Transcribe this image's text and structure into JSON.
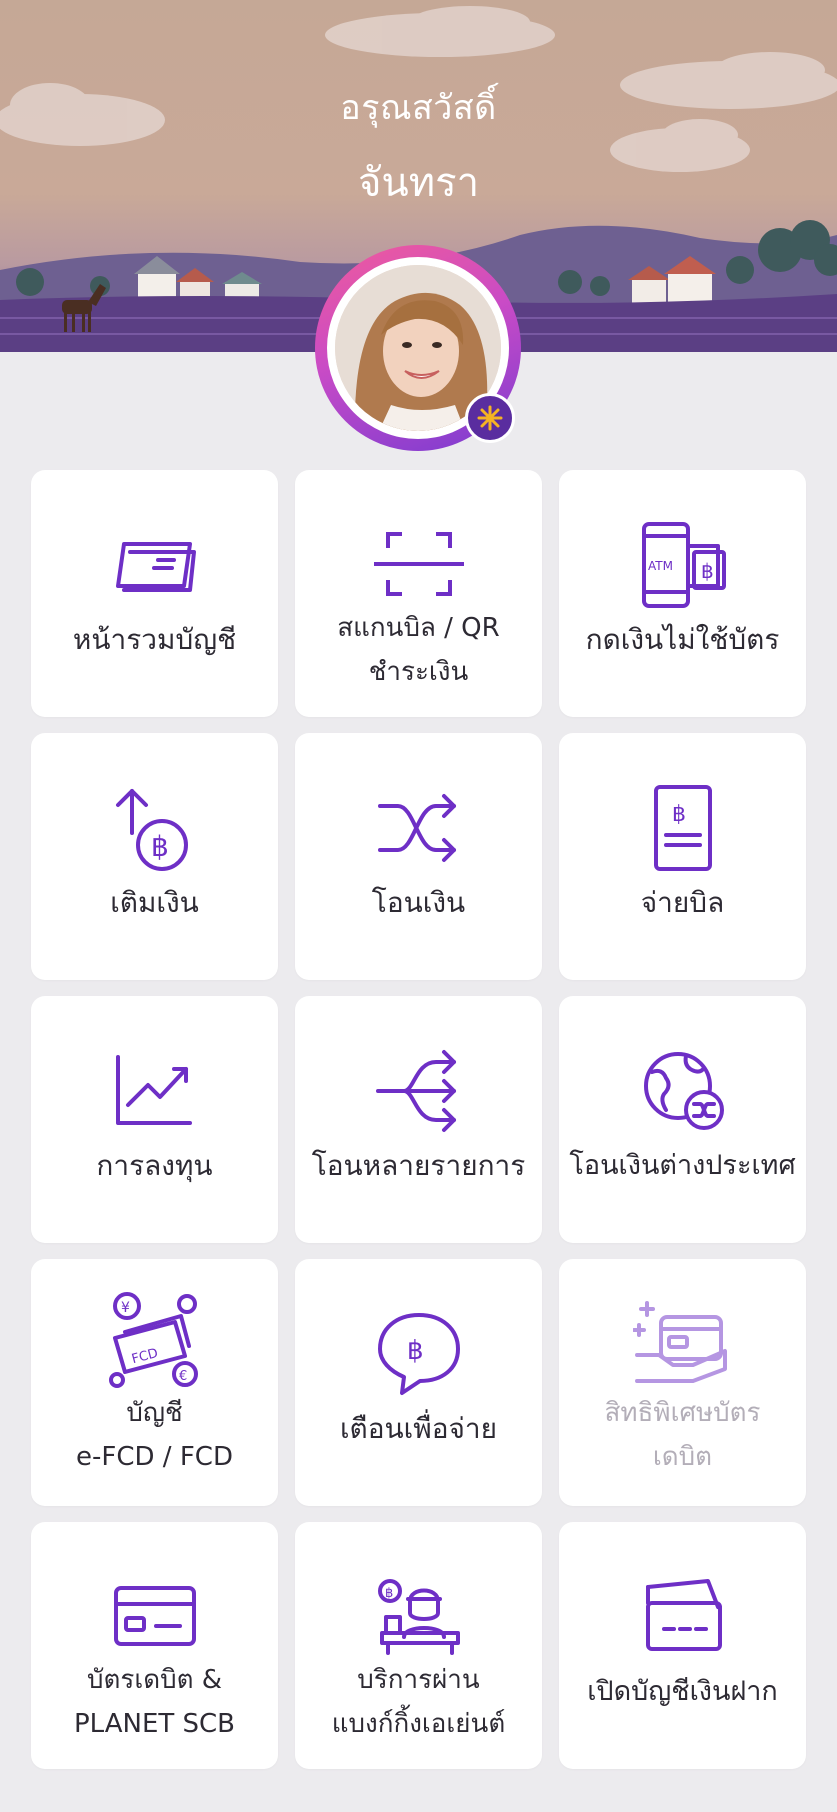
{
  "header": {
    "greeting": "อรุณสวัสดิ์",
    "username": "จันทรา"
  },
  "colors": {
    "accent": "#6E2FC6",
    "tile_background": "#FFFFFF",
    "page_background": "#ECEBEE",
    "disabled_text": "#B3AEB8"
  },
  "menu": [
    {
      "icon": "account-summary-icon",
      "label": "หน้ารวมบัญชี",
      "line2": "",
      "enabled": true
    },
    {
      "icon": "scan-qr-icon",
      "label": "สแกนบิล / QR",
      "line2": "ชำระเงิน",
      "enabled": true
    },
    {
      "icon": "atm-cardless-icon",
      "label": "กดเงินไม่ใช้บัตร",
      "line2": "",
      "enabled": true
    },
    {
      "icon": "top-up-icon",
      "label": "เติมเงิน",
      "line2": "",
      "enabled": true
    },
    {
      "icon": "transfer-icon",
      "label": "โอนเงิน",
      "line2": "",
      "enabled": true
    },
    {
      "icon": "bill-payment-icon",
      "label": "จ่ายบิล",
      "line2": "",
      "enabled": true
    },
    {
      "icon": "investment-chart-icon",
      "label": "การลงทุน",
      "line2": "",
      "enabled": true
    },
    {
      "icon": "multi-transfer-icon",
      "label": "โอนหลายรายการ",
      "line2": "",
      "enabled": true
    },
    {
      "icon": "international-transfer-icon",
      "label": "โอนเงินต่างประเทศ",
      "line2": "",
      "enabled": true
    },
    {
      "icon": "fcd-account-icon",
      "label": "บัญชี",
      "line2": "e-FCD / FCD",
      "enabled": true
    },
    {
      "icon": "payment-reminder-icon",
      "label": "เตือนเพื่อจ่าย",
      "line2": "",
      "enabled": true
    },
    {
      "icon": "debit-privilege-icon",
      "label": "สิทธิพิเศษบัตร",
      "line2": "เดบิต",
      "enabled": false
    },
    {
      "icon": "credit-card-icon",
      "label": "บัตรเดบิต &",
      "line2": "PLANET SCB",
      "enabled": true
    },
    {
      "icon": "banking-agent-icon",
      "label": "บริการผ่าน",
      "line2": "แบงก์กิ้งเอเย่นต์",
      "enabled": true
    },
    {
      "icon": "open-deposit-account-icon",
      "label": "เปิดบัญชีเงินฝาก",
      "line2": "",
      "enabled": true
    }
  ]
}
